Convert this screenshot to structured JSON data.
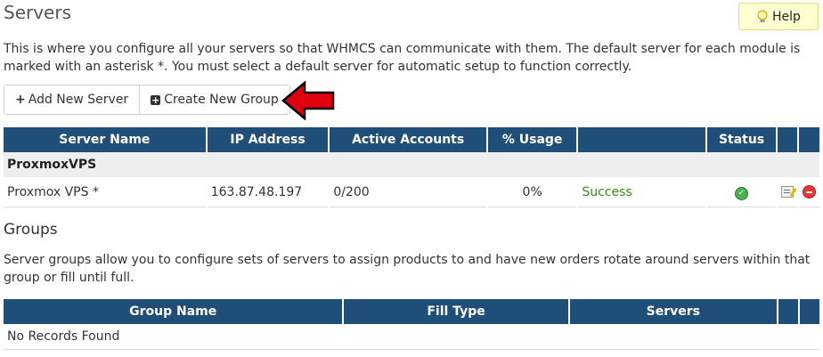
{
  "page": {
    "title": "Servers",
    "help_label": "Help",
    "intro": "This is where you configure all your servers so that WHMCS can communicate with them. The default server for each module is marked with an asterisk *. You must select a default server for automatic setup to function correctly."
  },
  "toolbar": {
    "add_server_label": "Add New Server",
    "create_group_label": "Create New Group"
  },
  "servers_table": {
    "headers": [
      "Server Name",
      "IP Address",
      "Active Accounts",
      "% Usage",
      "",
      "Status",
      "",
      ""
    ],
    "group_name": "ProxmoxVPS",
    "rows": [
      {
        "name": "Proxmox VPS *",
        "ip": "163.87.48.197",
        "active_accounts": "0/200",
        "usage": "0%",
        "test_result": "Success",
        "status_icon": "green-check-circle"
      }
    ]
  },
  "groups": {
    "title": "Groups",
    "intro": "Server groups allow you to configure sets of servers to assign products to and have new orders rotate around servers within that group or fill until full.",
    "headers": [
      "Group Name",
      "Fill Type",
      "Servers",
      "",
      ""
    ],
    "empty_text": "No Records Found"
  },
  "colors": {
    "header_bg": "#1f4e79",
    "success": "#3b8a1d",
    "help_bg": "#ffffd2",
    "arrow": "#e0000f"
  }
}
